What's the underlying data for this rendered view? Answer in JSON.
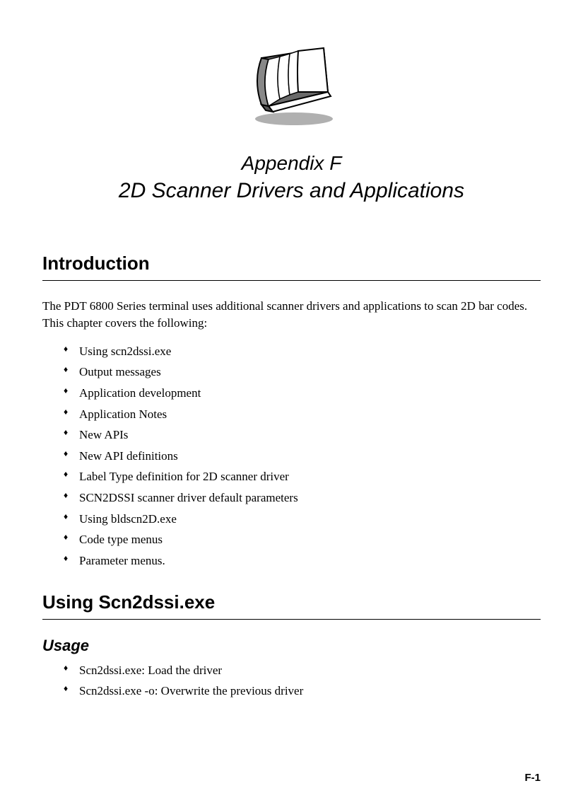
{
  "appendix": {
    "label": "Appendix  F",
    "title": "2D Scanner Drivers and Applications"
  },
  "sections": {
    "introduction": {
      "heading": "Introduction",
      "paragraph": "The PDT 6800 Series terminal uses additional scanner drivers and applications to scan 2D bar codes. This chapter covers the following:",
      "bullets": [
        "Using scn2dssi.exe",
        "Output messages",
        "Application development",
        "Application Notes",
        "New APIs",
        "New API definitions",
        "Label Type definition for 2D scanner driver",
        "SCN2DSSI scanner driver default parameters",
        "Using bldscn2D.exe",
        "Code type menus",
        "Parameter menus."
      ]
    },
    "using_scn2dssi": {
      "heading": "Using Scn2dssi.exe",
      "usage": {
        "heading": "Usage",
        "bullets": [
          "Scn2dssi.exe: Load the driver",
          "Scn2dssi.exe -o: Overwrite the previous driver"
        ]
      }
    }
  },
  "page_number": "F-1"
}
